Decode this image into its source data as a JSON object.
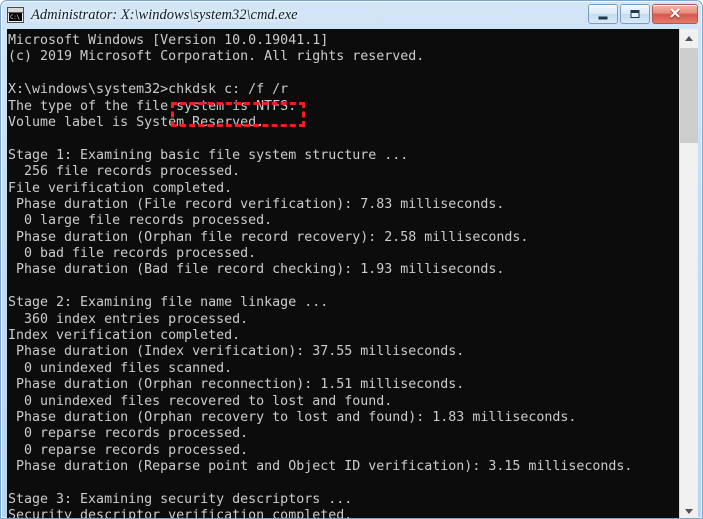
{
  "window": {
    "title": "Administrator: X:\\windows\\system32\\cmd.exe",
    "icon_name": "cmd-console-icon",
    "icon_glyph": "C:\\",
    "controls": {
      "minimize_label": "",
      "maximize_label": "",
      "close_label": "✕"
    }
  },
  "console": {
    "background_color": "#0c0c0c",
    "text_color": "#cccccc",
    "lines": [
      "Microsoft Windows [Version 10.0.19041.1]",
      "(c) 2019 Microsoft Corporation. All rights reserved.",
      "",
      "X:\\windows\\system32>chkdsk c: /f /r",
      "The type of the file system is NTFS.",
      "Volume label is System Reserved.",
      "",
      "Stage 1: Examining basic file system structure ...",
      "  256 file records processed.",
      "File verification completed.",
      " Phase duration (File record verification): 7.83 milliseconds.",
      "  0 large file records processed.",
      " Phase duration (Orphan file record recovery): 2.58 milliseconds.",
      "  0 bad file records processed.",
      " Phase duration (Bad file record checking): 1.93 milliseconds.",
      "",
      "Stage 2: Examining file name linkage ...",
      "  360 index entries processed.",
      "Index verification completed.",
      " Phase duration (Index verification): 37.55 milliseconds.",
      "  0 unindexed files scanned.",
      " Phase duration (Orphan reconnection): 1.51 milliseconds.",
      "  0 unindexed files recovered to lost and found.",
      " Phase duration (Orphan recovery to lost and found): 1.83 milliseconds.",
      "  0 reparse records processed.",
      "  0 reparse records processed.",
      " Phase duration (Reparse point and Object ID verification): 3.15 milliseconds.",
      "",
      "Stage 3: Examining security descriptors ...",
      "Security descriptor verification completed."
    ],
    "prompt": "X:\\windows\\system32>",
    "command": "chkdsk c: /f /r"
  },
  "annotation": {
    "type": "dashed-rectangle-highlight",
    "color": "#f21d1d",
    "targets_text": "chkdsk c: /f /r"
  },
  "scrollbar": {
    "up_arrow": "▲",
    "down_arrow": "▼",
    "thumb_position": "near-top"
  }
}
